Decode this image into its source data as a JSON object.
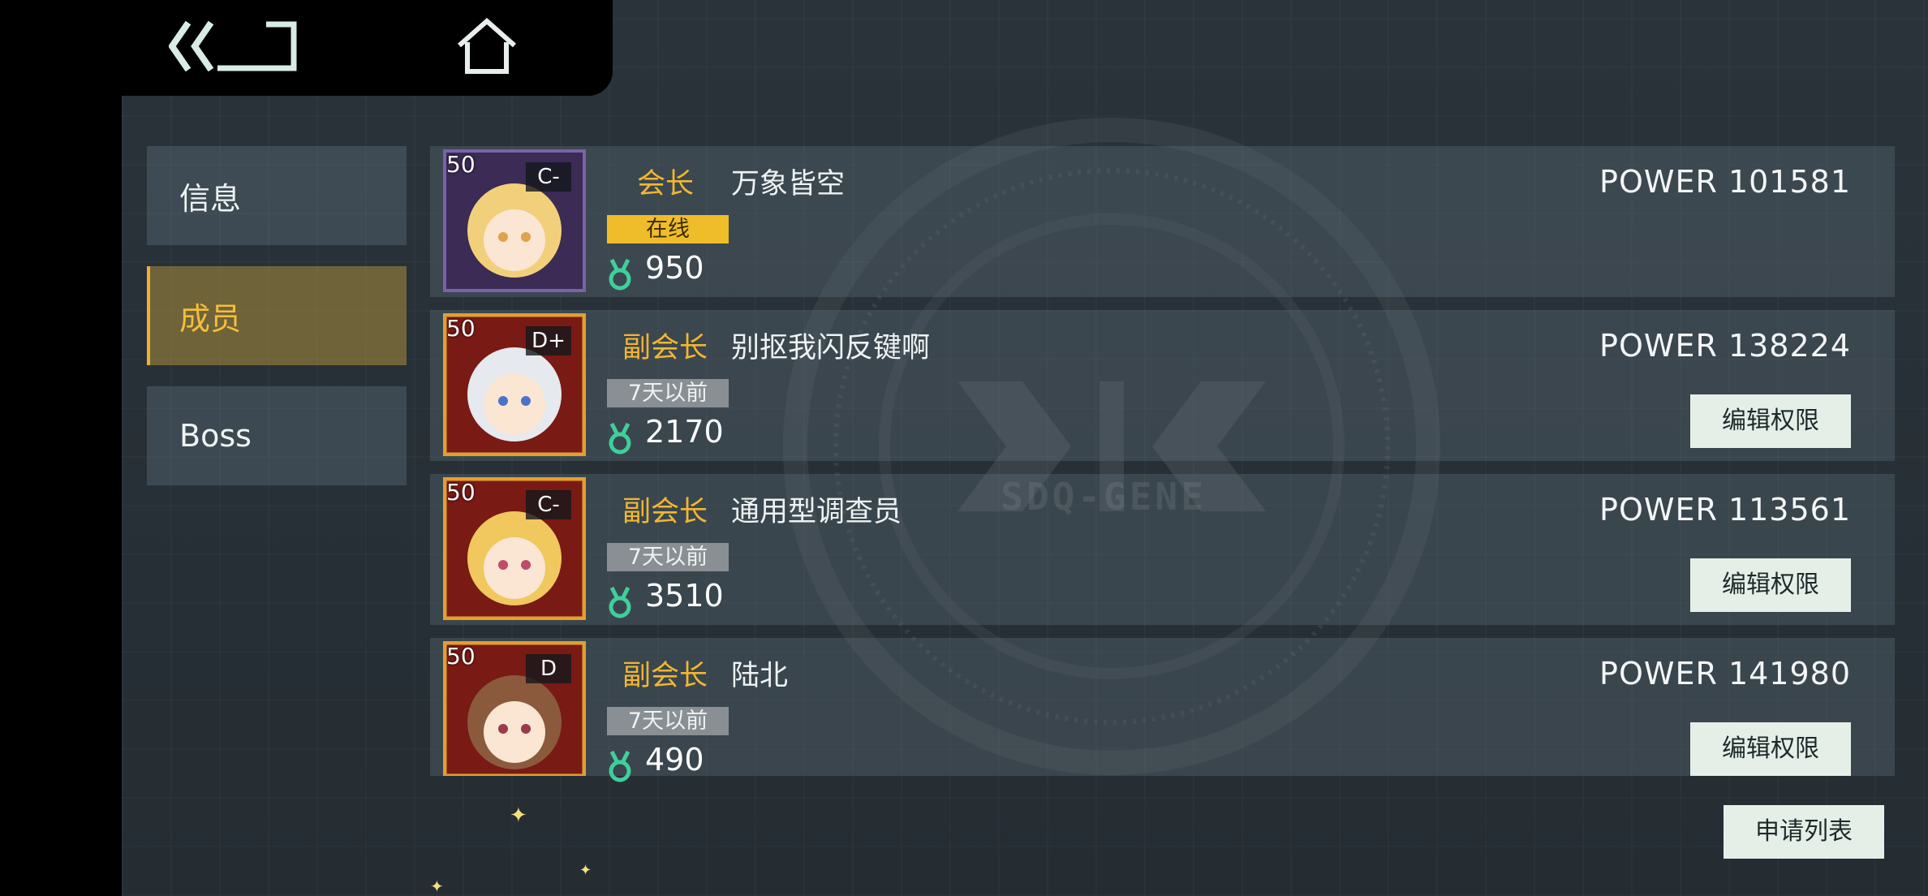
{
  "nav": {
    "items": [
      {
        "label": "信息"
      },
      {
        "label": "成员"
      },
      {
        "label": "Boss"
      }
    ],
    "active_index": 1
  },
  "emblem": {
    "text": "SDQ-GENE"
  },
  "members": [
    {
      "level": "50",
      "rank": "C-",
      "role": "会长",
      "name": "万象皆空",
      "status": "在线",
      "status_type": "online",
      "points": "950",
      "power": "POWER 101581",
      "edit": null,
      "hair": "#f2cf7a"
    },
    {
      "level": "50",
      "rank": "D+",
      "role": "副会长",
      "name": "别抠我闪反键啊",
      "status": "7天以前",
      "status_type": "away",
      "points": "2170",
      "power": "POWER 138224",
      "edit": "编辑权限",
      "hair": "#e6e9ee"
    },
    {
      "level": "50",
      "rank": "C-",
      "role": "副会长",
      "name": "通用型调查员",
      "status": "7天以前",
      "status_type": "away",
      "points": "3510",
      "power": "POWER 113561",
      "edit": "编辑权限",
      "hair": "#f0c85e"
    },
    {
      "level": "50",
      "rank": "D",
      "role": "副会长",
      "name": "陆北",
      "status": "7天以前",
      "status_type": "away",
      "points": "490",
      "power": "POWER 141980",
      "edit": "编辑权限",
      "hair": "#8b5a3c"
    }
  ],
  "apply_list_label": "申请列表",
  "colors": {
    "accent": "#f2b630",
    "button_bg": "#e5efe8",
    "online": "#f0bd2a"
  }
}
